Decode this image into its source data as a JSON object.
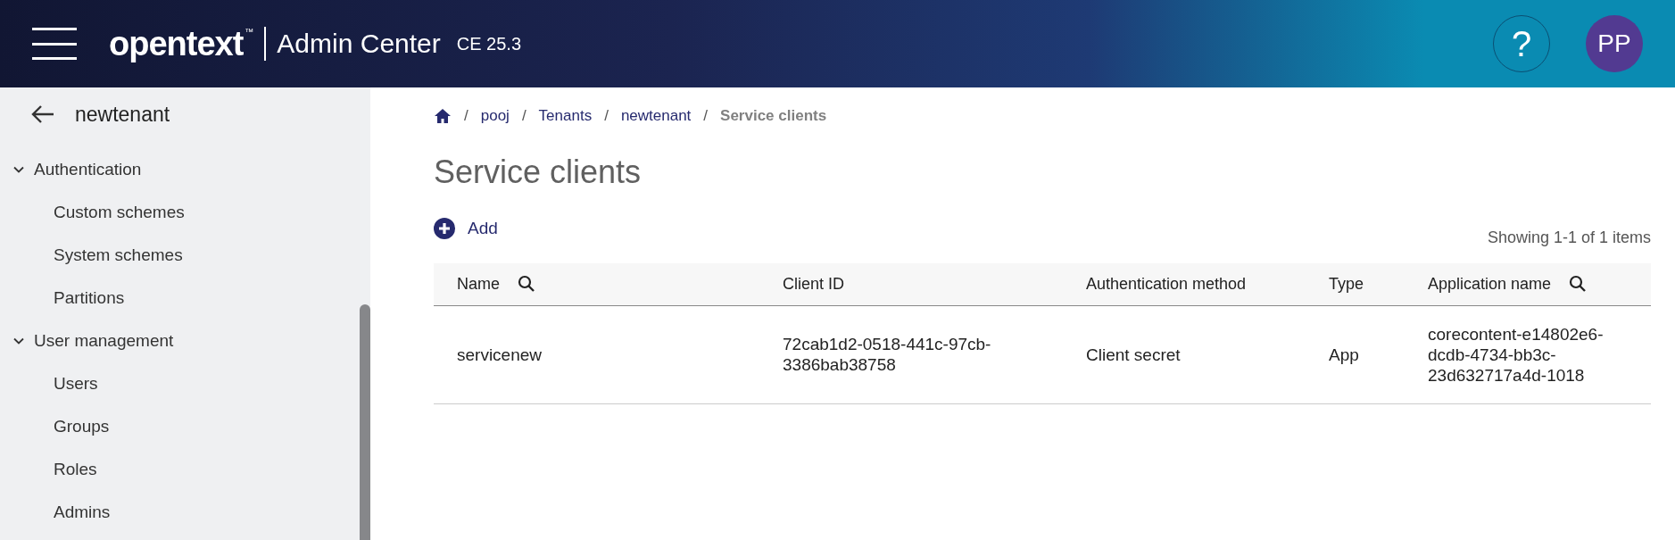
{
  "header": {
    "brand": "opentext",
    "trademark": "™",
    "product": "Admin Center",
    "version": "CE 25.3",
    "help": "?",
    "avatar": "PP"
  },
  "sidebar": {
    "title": "newtenant",
    "sections": [
      {
        "label": "Authentication",
        "expanded": true,
        "children": [
          {
            "label": "Custom schemes"
          },
          {
            "label": "System schemes"
          },
          {
            "label": "Partitions"
          }
        ]
      },
      {
        "label": "User management",
        "expanded": true,
        "children": [
          {
            "label": "Users"
          },
          {
            "label": "Groups"
          },
          {
            "label": "Roles"
          },
          {
            "label": "Admins"
          }
        ]
      }
    ]
  },
  "breadcrumb": [
    {
      "separator": "/",
      "label": "pooj"
    },
    {
      "separator": "/",
      "label": "Tenants"
    },
    {
      "separator": "/",
      "label": "newtenant"
    },
    {
      "separator": "/",
      "label": "Service clients"
    }
  ],
  "page_title": "Service clients",
  "add_label": "Add",
  "count": "Showing 1-1 of 1 items",
  "table": {
    "columns": [
      {
        "label": "Name",
        "searchable": true
      },
      {
        "label": "Client ID",
        "searchable": false
      },
      {
        "label": "Authentication method",
        "searchable": false
      },
      {
        "label": "Type",
        "searchable": false
      },
      {
        "label": "Application name",
        "searchable": true
      }
    ],
    "rows": [
      [
        "servicenew",
        "72cab1d2-0518-441c-97cb-3386bab38758",
        "Client secret",
        "App",
        "corecontent-e14802e6-dcdb-4734-bb3c-23d632717a4d-1018"
      ]
    ]
  }
}
